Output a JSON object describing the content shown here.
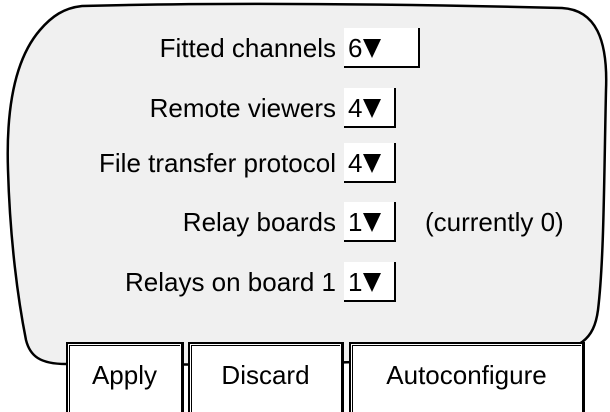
{
  "fields": [
    {
      "label": "Fitted channels",
      "value": "6 "
    },
    {
      "label": "Remote viewers",
      "value": "4"
    },
    {
      "label": "File transfer protocol",
      "value": "4"
    },
    {
      "label": "Relay boards",
      "value": "1",
      "note": "(currently 0)"
    },
    {
      "label": "Relays on board 1",
      "value": "1"
    }
  ],
  "buttons": {
    "apply": "Apply",
    "discard": "Discard",
    "autoconfigure": "Autoconfigure"
  },
  "icons": {
    "dropdown": "triangle-down-icon"
  },
  "colors": {
    "background": "#ffffff",
    "panel": "#f0f0f0",
    "line": "#000000"
  }
}
